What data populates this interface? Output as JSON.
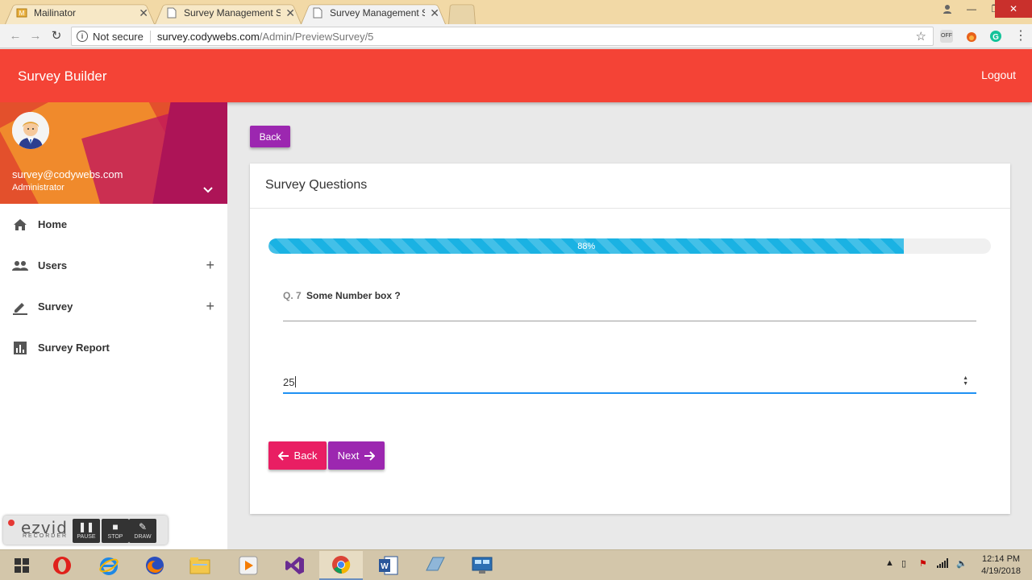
{
  "browser": {
    "tabs": [
      {
        "title": "Mailinator",
        "active": false
      },
      {
        "title": "Survey Management Syst",
        "active": false
      },
      {
        "title": "Survey Management Syst",
        "active": true
      }
    ],
    "security_label": "Not secure",
    "url_host": "survey.codywebs.com",
    "url_path": "/Admin/PreviewSurvey/5",
    "extension_off_label": "OFF"
  },
  "header": {
    "app_title": "Survey Builder",
    "logout_label": "Logout",
    "color": "#f44336"
  },
  "sidebar": {
    "user": {
      "email": "survey@codywebs.com",
      "role": "Administrator"
    },
    "items": [
      {
        "label": "Home",
        "icon": "home-icon",
        "expandable": false
      },
      {
        "label": "Users",
        "icon": "users-icon",
        "expandable": true
      },
      {
        "label": "Survey",
        "icon": "pencil-icon",
        "expandable": true
      },
      {
        "label": "Survey Report",
        "icon": "bar-chart-icon",
        "expandable": false
      }
    ]
  },
  "main": {
    "back_label": "Back",
    "card_title": "Survey Questions",
    "progress": {
      "percent": 88,
      "label": "88%"
    },
    "question": {
      "number": "Q. 7",
      "text": "Some Number box ?"
    },
    "answer_value": "25",
    "nav": {
      "back_label": "Back",
      "next_label": "Next"
    }
  },
  "recorder": {
    "logo": "ezvid",
    "sub": "RECORDER",
    "buttons": [
      "PAUSE",
      "STOP",
      "DRAW"
    ]
  },
  "taskbar": {
    "time": "12:14 PM",
    "date": "4/19/2018"
  }
}
